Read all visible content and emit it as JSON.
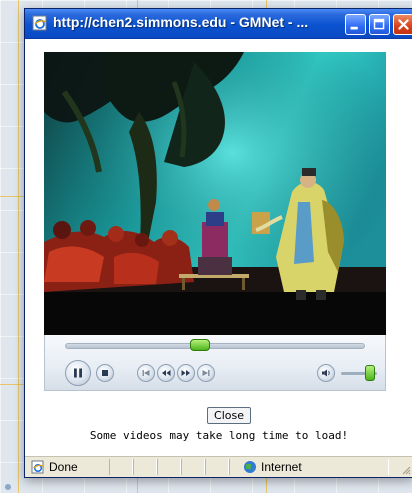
{
  "window": {
    "title": "http://chen2.simmons.edu - GMNet - ...",
    "buttons": {
      "minimize": "minimize-icon",
      "maximize": "maximize-icon",
      "close": "close-icon"
    }
  },
  "player": {
    "seek_progress": 0.45,
    "volume_level": 0.8,
    "controls": [
      "pause-icon",
      "stop-icon",
      "previous-icon",
      "rewind-icon",
      "fast-forward-icon",
      "next-icon",
      "mute-icon"
    ]
  },
  "dialog": {
    "close_label": "Close",
    "notice": "Some videos may take long time to load!"
  },
  "statusbar": {
    "status": "Done",
    "zone": "Internet"
  },
  "colors": {
    "titlebar": "#0b53d1",
    "seek_handle": "#4cb51c",
    "close_button": "#d9401a"
  }
}
